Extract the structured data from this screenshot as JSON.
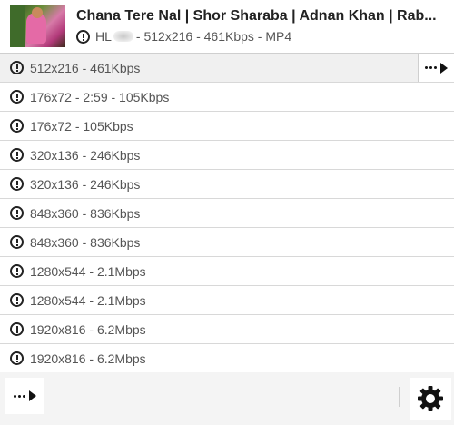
{
  "video": {
    "title": "Chana Tere Nal | Shor Sharaba | Adnan Khan | Rab...",
    "subtitle_prefix": "HL",
    "subtitle_rest": "- 512x216 - 461Kbps - MP4"
  },
  "formats": [
    {
      "label": "512x216 - 461Kbps",
      "selected": true
    },
    {
      "label": "176x72 - 2:59 - 105Kbps"
    },
    {
      "label": "176x72 - 105Kbps"
    },
    {
      "label": "320x136 - 246Kbps"
    },
    {
      "label": "320x136 - 246Kbps"
    },
    {
      "label": "848x360 - 836Kbps"
    },
    {
      "label": "848x360 - 836Kbps"
    },
    {
      "label": "1280x544 - 2.1Mbps"
    },
    {
      "label": "1280x544 - 2.1Mbps"
    },
    {
      "label": "1920x816 - 6.2Mbps"
    },
    {
      "label": "1920x816 - 6.2Mbps"
    }
  ],
  "icons": {
    "row_status": "warning-circle-icon",
    "more": "more-actions-icon",
    "settings": "gear-icon"
  },
  "colors": {
    "selected_row": "#f0f0f0",
    "text_muted": "#555555",
    "footer": "#f4f4f4"
  }
}
